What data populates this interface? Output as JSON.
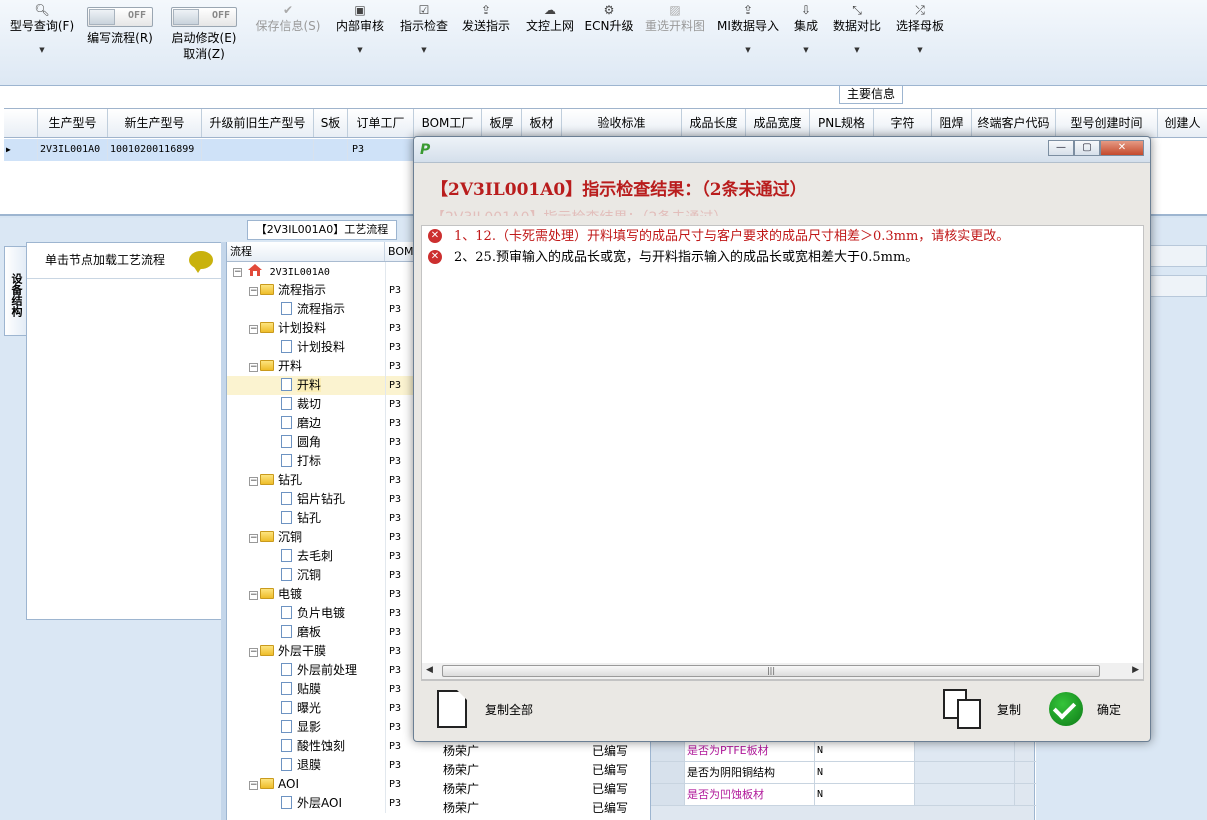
{
  "toolbar": {
    "items": [
      {
        "label": "型号查询(F)",
        "icon": "search-icon"
      },
      {
        "label": "编写流程(R)",
        "toggle": "OFF"
      },
      {
        "label": "启动修改(E)",
        "label2": "取消(Z)",
        "toggle": "OFF"
      },
      {
        "label": "保存信息(S)",
        "icon": "check-icon",
        "disabled": true
      },
      {
        "label": "内部审核",
        "icon": "print-icon"
      },
      {
        "label": "指示检查",
        "icon": "checkbox-icon"
      },
      {
        "label": "发送指示",
        "icon": "upload-icon"
      },
      {
        "label": "文控上网",
        "icon": "cloud-upload-icon"
      },
      {
        "label": "ECN升级",
        "icon": "gear-icon"
      },
      {
        "label": "重选开料图",
        "icon": "image-icon",
        "disabled": true
      },
      {
        "label": "MI数据导入",
        "icon": "upload-icon"
      },
      {
        "label": "集成",
        "icon": "download-icon"
      },
      {
        "label": "数据对比",
        "icon": "compress-icon"
      },
      {
        "label": "选择母板",
        "icon": "shuffle-icon"
      }
    ]
  },
  "main_info": {
    "tab_label": "主要信息",
    "columns": [
      "生产型号",
      "新生产型号",
      "升级前旧生产型号",
      "S板",
      "订单工厂",
      "BOM工厂",
      "板厚",
      "板材",
      "验收标准",
      "成品长度",
      "成品宽度",
      "PNL规格",
      "字符",
      "阻焊",
      "终端客户代码",
      "型号创建时间",
      "创建人"
    ],
    "row": [
      "2V3IL001A0",
      "10010200116899",
      "",
      "",
      "P3",
      "",
      "",
      "",
      "",
      "",
      "",
      "",
      "",
      "",
      "",
      "",
      ""
    ]
  },
  "left": {
    "side_tab": "设备结构",
    "panel_head": "单击节点加载工艺流程"
  },
  "flow": {
    "tab_label": "【2V3IL001A0】工艺流程",
    "col_flow": "流程",
    "col_bom": "BOM",
    "root": "2V3IL001A0",
    "rows": [
      {
        "name": "流程指示",
        "type": "folder",
        "bom": "P3"
      },
      {
        "name": "流程指示",
        "type": "doc",
        "bom": "P3"
      },
      {
        "name": "计划投料",
        "type": "folder",
        "bom": "P3"
      },
      {
        "name": "计划投料",
        "type": "doc",
        "bom": "P3"
      },
      {
        "name": "开料",
        "type": "folder",
        "bom": "P3"
      },
      {
        "name": "开料",
        "type": "doc",
        "bom": "P3",
        "selected": true
      },
      {
        "name": "裁切",
        "type": "doc",
        "bom": "P3"
      },
      {
        "name": "磨边",
        "type": "doc",
        "bom": "P3"
      },
      {
        "name": "圆角",
        "type": "doc",
        "bom": "P3"
      },
      {
        "name": "打标",
        "type": "doc",
        "bom": "P3"
      },
      {
        "name": "钻孔",
        "type": "folder",
        "bom": "P3"
      },
      {
        "name": "铝片钻孔",
        "type": "doc",
        "bom": "P3"
      },
      {
        "name": "钻孔",
        "type": "doc",
        "bom": "P3"
      },
      {
        "name": "沉铜",
        "type": "folder",
        "bom": "P3"
      },
      {
        "name": "去毛刺",
        "type": "doc",
        "bom": "P3"
      },
      {
        "name": "沉铜",
        "type": "doc",
        "bom": "P3"
      },
      {
        "name": "电镀",
        "type": "folder",
        "bom": "P3"
      },
      {
        "name": "负片电镀",
        "type": "doc",
        "bom": "P3"
      },
      {
        "name": "磨板",
        "type": "doc",
        "bom": "P3"
      },
      {
        "name": "外层干膜",
        "type": "folder",
        "bom": "P3"
      },
      {
        "name": "外层前处理",
        "type": "doc",
        "bom": "P3"
      },
      {
        "name": "贴膜",
        "type": "doc",
        "bom": "P3"
      },
      {
        "name": "曝光",
        "type": "doc",
        "bom": "P3"
      },
      {
        "name": "显影",
        "type": "doc",
        "bom": "P3"
      },
      {
        "name": "酸性蚀刻",
        "type": "doc",
        "bom": "P3"
      },
      {
        "name": "退膜",
        "type": "doc",
        "bom": "P3"
      },
      {
        "name": "AOI",
        "type": "folder",
        "bom": "P3"
      },
      {
        "name": "外层AOI",
        "type": "doc",
        "bom": "P3"
      }
    ]
  },
  "behind": {
    "people_rows": [
      {
        "who": "杨荣广",
        "status": "已编写"
      },
      {
        "who": "杨荣广",
        "status": "已编写"
      },
      {
        "who": "杨荣广",
        "status": "已编写"
      },
      {
        "who": "杨荣广",
        "status": "已编写"
      }
    ],
    "props": [
      {
        "label": "是否为PTFE板材",
        "value": "N",
        "color": "#b0179a"
      },
      {
        "label": "是否为阴阳铜结构",
        "value": "N",
        "color": "#000000"
      },
      {
        "label": "是否为凹蚀板材",
        "value": "N",
        "color": "#b0179a"
      }
    ]
  },
  "dialog": {
    "heading": "【2V3IL001A0】指示检查结果：（2条未通过）",
    "ghost": "【2V3IL001A0】指示检查结果：（2条未通过）",
    "messages": [
      {
        "text": "1、12.（卡死需处理）开料填写的成品尺寸与客户要求的成品尺寸相差＞0.3mm，请核实更改。",
        "red": true
      },
      {
        "text": "2、25.预审输入的成品长或宽，与开料指示输入的成品长或宽相差大于0.5mm。",
        "red": false
      }
    ],
    "copy_all_label": "复制全部",
    "copy_label": "复制",
    "ok_label": "确定"
  }
}
